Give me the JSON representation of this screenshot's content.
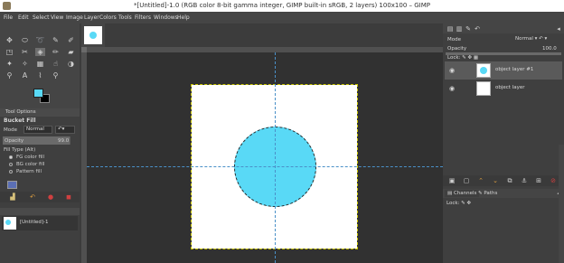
{
  "window": {
    "title": "*[Untitled]-1.0 (RGB color 8-bit gamma integer, GIMP built-in sRGB, 2 layers) 100x100 – GIMP"
  },
  "menu": [
    "File",
    "Edit",
    "Select",
    "View",
    "Image",
    "Layer",
    "Colors",
    "Tools",
    "Filters",
    "Windows",
    "Help"
  ],
  "colors": {
    "foreground": "#59d9f6",
    "background": "#000000",
    "circle_fill": "#59d9f6"
  },
  "tool_options": {
    "tab": "Tool Options",
    "tool_name": "Bucket Fill",
    "mode_label": "Mode",
    "mode_value": "Normal",
    "opacity_label": "Opacity",
    "opacity_value": "99.0",
    "opacity_fraction": 0.99,
    "fill_type_label": "Fill Type  (Alt)",
    "fill_options": [
      {
        "label": "FG color fill",
        "selected": true
      },
      {
        "label": "BG color fill",
        "selected": false
      },
      {
        "label": "Pattern fill",
        "selected": false
      }
    ]
  },
  "images_panel": {
    "image_name": "[Untitled]-1"
  },
  "layers": {
    "mode_label": "Mode",
    "mode_value": "Normal",
    "opacity_label": "Opacity",
    "opacity_value": "100.0",
    "lock_label": "Lock:",
    "items": [
      {
        "name": "object layer #1",
        "selected": true
      },
      {
        "name": "object layer",
        "selected": false
      }
    ]
  },
  "bottom_tabs": {
    "channels": "Channels",
    "paths": "Paths",
    "lock_label": "Lock:"
  }
}
